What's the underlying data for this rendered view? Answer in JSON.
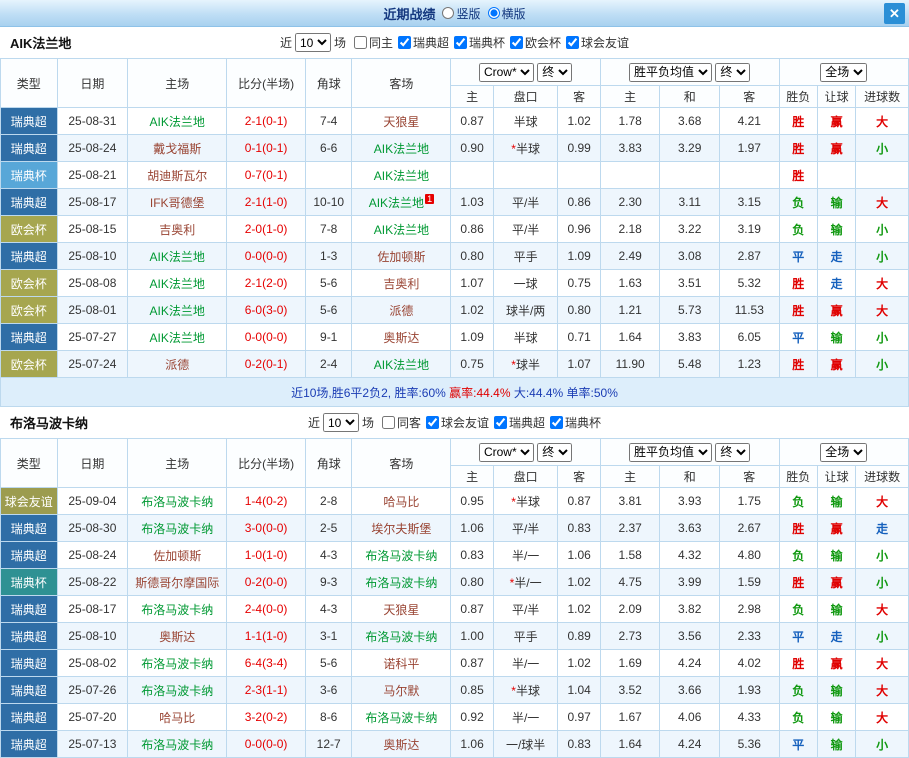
{
  "titlebar": {
    "title": "近期战绩",
    "vertical": "竖版",
    "horizontal": "横版",
    "selected": "横版",
    "close": "✕"
  },
  "controls": {
    "near": "近",
    "count": "10",
    "games": "场",
    "company": "Crow*",
    "final": "终",
    "avg": "胜平负均值",
    "full": "全场"
  },
  "columns": {
    "type": "类型",
    "date": "日期",
    "home": "主场",
    "score": "比分(半场)",
    "corner": "角球",
    "away": "客场",
    "h": "主",
    "handicap": "盘口",
    "a": "客",
    "avg_h": "主",
    "avg_d": "和",
    "avg_a": "客",
    "wl": "胜负",
    "let": "让球",
    "goals": "进球数"
  },
  "colors": {
    "result": {
      "胜": "#e00000",
      "负": "#119911",
      "平": "#1560bd",
      "赢": "#e00000",
      "输": "#119911",
      "走": "#1560bd",
      "大": "#e00000",
      "小": "#119911"
    },
    "focal_team": "#009933",
    "opponent": "#994433",
    "score": "#e60000"
  },
  "sections": [
    {
      "team": "AIK法兰地",
      "filters": [
        {
          "label": "同主",
          "checked": false
        },
        {
          "label": "瑞典超",
          "checked": true
        },
        {
          "label": "瑞典杯",
          "checked": true
        },
        {
          "label": "欧会杯",
          "checked": true
        },
        {
          "label": "球会友谊",
          "checked": true
        }
      ],
      "rows": [
        {
          "type": "瑞典超",
          "type_color": "#2f6ea6",
          "date": "25-08-31",
          "home": "AIK法兰地",
          "home_focal": true,
          "score": "2-1(0-1)",
          "corner": "7-4",
          "away": "天狼星",
          "away_focal": false,
          "away_sup": "",
          "odds_home": "0.87",
          "handicap": "半球",
          "odds_away": "1.02",
          "avg_home": "1.78",
          "avg_draw": "3.68",
          "avg_away": "4.21",
          "wl": "胜",
          "let": "赢",
          "goals": "大"
        },
        {
          "type": "瑞典超",
          "type_color": "#2f6ea6",
          "date": "25-08-24",
          "home": "戴戈福斯",
          "home_focal": false,
          "score": "0-1(0-1)",
          "corner": "6-6",
          "away": "AIK法兰地",
          "away_focal": true,
          "away_sup": "",
          "odds_home": "0.90",
          "handicap": "*半球",
          "odds_away": "0.99",
          "avg_home": "3.83",
          "avg_draw": "3.29",
          "avg_away": "1.97",
          "wl": "胜",
          "let": "赢",
          "goals": "小"
        },
        {
          "type": "瑞典杯",
          "type_color": "#58a7d8",
          "date": "25-08-21",
          "home": "胡迪斯瓦尔",
          "home_focal": false,
          "score": "0-7(0-1)",
          "corner": "",
          "away": "AIK法兰地",
          "away_focal": true,
          "away_sup": "",
          "odds_home": "",
          "handicap": "",
          "odds_away": "",
          "avg_home": "",
          "avg_draw": "",
          "avg_away": "",
          "wl": "胜",
          "let": "",
          "goals": ""
        },
        {
          "type": "瑞典超",
          "type_color": "#2f6ea6",
          "date": "25-08-17",
          "home": "IFK哥德堡",
          "home_focal": false,
          "score": "2-1(1-0)",
          "corner": "10-10",
          "away": "AIK法兰地",
          "away_focal": true,
          "away_sup": "1",
          "odds_home": "1.03",
          "handicap": "平/半",
          "odds_away": "0.86",
          "avg_home": "2.30",
          "avg_draw": "3.11",
          "avg_away": "3.15",
          "wl": "负",
          "let": "输",
          "goals": "大"
        },
        {
          "type": "欧会杯",
          "type_color": "#a6a64f",
          "date": "25-08-15",
          "home": "吉奥利",
          "home_focal": false,
          "score": "2-0(1-0)",
          "corner": "7-8",
          "away": "AIK法兰地",
          "away_focal": true,
          "away_sup": "",
          "odds_home": "0.86",
          "handicap": "平/半",
          "odds_away": "0.96",
          "avg_home": "2.18",
          "avg_draw": "3.22",
          "avg_away": "3.19",
          "wl": "负",
          "let": "输",
          "goals": "小"
        },
        {
          "type": "瑞典超",
          "type_color": "#2f6ea6",
          "date": "25-08-10",
          "home": "AIK法兰地",
          "home_focal": true,
          "score": "0-0(0-0)",
          "corner": "1-3",
          "away": "佐加顿斯",
          "away_focal": false,
          "away_sup": "",
          "odds_home": "0.80",
          "handicap": "平手",
          "odds_away": "1.09",
          "avg_home": "2.49",
          "avg_draw": "3.08",
          "avg_away": "2.87",
          "wl": "平",
          "let": "走",
          "goals": "小"
        },
        {
          "type": "欧会杯",
          "type_color": "#a6a64f",
          "date": "25-08-08",
          "home": "AIK法兰地",
          "home_focal": true,
          "score": "2-1(2-0)",
          "corner": "5-6",
          "away": "吉奥利",
          "away_focal": false,
          "away_sup": "",
          "odds_home": "1.07",
          "handicap": "一球",
          "odds_away": "0.75",
          "avg_home": "1.63",
          "avg_draw": "3.51",
          "avg_away": "5.32",
          "wl": "胜",
          "let": "走",
          "goals": "大"
        },
        {
          "type": "欧会杯",
          "type_color": "#a6a64f",
          "date": "25-08-01",
          "home": "AIK法兰地",
          "home_focal": true,
          "score": "6-0(3-0)",
          "corner": "5-6",
          "away": "派德",
          "away_focal": false,
          "away_sup": "",
          "odds_home": "1.02",
          "handicap": "球半/两",
          "odds_away": "0.80",
          "avg_home": "1.21",
          "avg_draw": "5.73",
          "avg_away": "11.53",
          "wl": "胜",
          "let": "赢",
          "goals": "大"
        },
        {
          "type": "瑞典超",
          "type_color": "#2f6ea6",
          "date": "25-07-27",
          "home": "AIK法兰地",
          "home_focal": true,
          "score": "0-0(0-0)",
          "corner": "9-1",
          "away": "奥斯达",
          "away_focal": false,
          "away_sup": "",
          "odds_home": "1.09",
          "handicap": "半球",
          "odds_away": "0.71",
          "avg_home": "1.64",
          "avg_draw": "3.83",
          "avg_away": "6.05",
          "wl": "平",
          "let": "输",
          "goals": "小"
        },
        {
          "type": "欧会杯",
          "type_color": "#a6a64f",
          "date": "25-07-24",
          "home": "派德",
          "home_focal": false,
          "score": "0-2(0-1)",
          "corner": "2-4",
          "away": "AIK法兰地",
          "away_focal": true,
          "away_sup": "",
          "odds_home": "0.75",
          "handicap": "*球半",
          "odds_away": "1.07",
          "avg_home": "11.90",
          "avg_draw": "5.48",
          "avg_away": "1.23",
          "wl": "胜",
          "let": "赢",
          "goals": "小"
        }
      ],
      "summary": [
        {
          "text": "近10场,胜6平2负2, 胜率:60%",
          "color": "#1a3cb4"
        },
        {
          "text": " 赢率:44.4%",
          "color": "#e00000"
        },
        {
          "text": " 大:44.4%",
          "color": "#1a3cb4"
        },
        {
          "text": " 单率:50%",
          "color": "#1a3cb4"
        }
      ]
    },
    {
      "team": "布洛马波卡纳",
      "filters": [
        {
          "label": "同客",
          "checked": false
        },
        {
          "label": "球会友谊",
          "checked": true
        },
        {
          "label": "瑞典超",
          "checked": true
        },
        {
          "label": "瑞典杯",
          "checked": true
        }
      ],
      "rows": [
        {
          "type": "球会友谊",
          "type_color": "#9c9c4f",
          "date": "25-09-04",
          "home": "布洛马波卡纳",
          "home_focal": true,
          "score": "1-4(0-2)",
          "corner": "2-8",
          "away": "哈马比",
          "away_focal": false,
          "away_sup": "",
          "odds_home": "0.95",
          "handicap": "*半球",
          "odds_away": "0.87",
          "avg_home": "3.81",
          "avg_draw": "3.93",
          "avg_away": "1.75",
          "wl": "负",
          "let": "输",
          "goals": "大"
        },
        {
          "type": "瑞典超",
          "type_color": "#2f6ea6",
          "date": "25-08-30",
          "home": "布洛马波卡纳",
          "home_focal": true,
          "score": "3-0(0-0)",
          "corner": "2-5",
          "away": "埃尔夫斯堡",
          "away_focal": false,
          "away_sup": "",
          "odds_home": "1.06",
          "handicap": "平/半",
          "odds_away": "0.83",
          "avg_home": "2.37",
          "avg_draw": "3.63",
          "avg_away": "2.67",
          "wl": "胜",
          "let": "赢",
          "goals": "走"
        },
        {
          "type": "瑞典超",
          "type_color": "#2f6ea6",
          "date": "25-08-24",
          "home": "佐加顿斯",
          "home_focal": false,
          "score": "1-0(1-0)",
          "corner": "4-3",
          "away": "布洛马波卡纳",
          "away_focal": true,
          "away_sup": "",
          "odds_home": "0.83",
          "handicap": "半/一",
          "odds_away": "1.06",
          "avg_home": "1.58",
          "avg_draw": "4.32",
          "avg_away": "4.80",
          "wl": "负",
          "let": "输",
          "goals": "小"
        },
        {
          "type": "瑞典杯",
          "type_color": "#2e9193",
          "date": "25-08-22",
          "home": "斯德哥尔摩国际",
          "home_focal": false,
          "score": "0-2(0-0)",
          "corner": "9-3",
          "away": "布洛马波卡纳",
          "away_focal": true,
          "away_sup": "",
          "odds_home": "0.80",
          "handicap": "*半/一",
          "odds_away": "1.02",
          "avg_home": "4.75",
          "avg_draw": "3.99",
          "avg_away": "1.59",
          "wl": "胜",
          "let": "赢",
          "goals": "小"
        },
        {
          "type": "瑞典超",
          "type_color": "#2f6ea6",
          "date": "25-08-17",
          "home": "布洛马波卡纳",
          "home_focal": true,
          "score": "2-4(0-0)",
          "corner": "4-3",
          "away": "天狼星",
          "away_focal": false,
          "away_sup": "",
          "odds_home": "0.87",
          "handicap": "平/半",
          "odds_away": "1.02",
          "avg_home": "2.09",
          "avg_draw": "3.82",
          "avg_away": "2.98",
          "wl": "负",
          "let": "输",
          "goals": "大"
        },
        {
          "type": "瑞典超",
          "type_color": "#2f6ea6",
          "date": "25-08-10",
          "home": "奥斯达",
          "home_focal": false,
          "score": "1-1(1-0)",
          "corner": "3-1",
          "away": "布洛马波卡纳",
          "away_focal": true,
          "away_sup": "",
          "odds_home": "1.00",
          "handicap": "平手",
          "odds_away": "0.89",
          "avg_home": "2.73",
          "avg_draw": "3.56",
          "avg_away": "2.33",
          "wl": "平",
          "let": "走",
          "goals": "小"
        },
        {
          "type": "瑞典超",
          "type_color": "#2f6ea6",
          "date": "25-08-02",
          "home": "布洛马波卡纳",
          "home_focal": true,
          "score": "6-4(3-4)",
          "corner": "5-6",
          "away": "诺科平",
          "away_focal": false,
          "away_sup": "",
          "odds_home": "0.87",
          "handicap": "半/一",
          "odds_away": "1.02",
          "avg_home": "1.69",
          "avg_draw": "4.24",
          "avg_away": "4.02",
          "wl": "胜",
          "let": "赢",
          "goals": "大"
        },
        {
          "type": "瑞典超",
          "type_color": "#2f6ea6",
          "date": "25-07-26",
          "home": "布洛马波卡纳",
          "home_focal": true,
          "score": "2-3(1-1)",
          "corner": "3-6",
          "away": "马尔默",
          "away_focal": false,
          "away_sup": "",
          "odds_home": "0.85",
          "handicap": "*半球",
          "odds_away": "1.04",
          "avg_home": "3.52",
          "avg_draw": "3.66",
          "avg_away": "1.93",
          "wl": "负",
          "let": "输",
          "goals": "大"
        },
        {
          "type": "瑞典超",
          "type_color": "#2f6ea6",
          "date": "25-07-20",
          "home": "哈马比",
          "home_focal": false,
          "score": "3-2(0-2)",
          "corner": "8-6",
          "away": "布洛马波卡纳",
          "away_focal": true,
          "away_sup": "",
          "odds_home": "0.92",
          "handicap": "半/一",
          "odds_away": "0.97",
          "avg_home": "1.67",
          "avg_draw": "4.06",
          "avg_away": "4.33",
          "wl": "负",
          "let": "输",
          "goals": "大"
        },
        {
          "type": "瑞典超",
          "type_color": "#2f6ea6",
          "date": "25-07-13",
          "home": "布洛马波卡纳",
          "home_focal": true,
          "score": "0-0(0-0)",
          "corner": "12-7",
          "away": "奥斯达",
          "away_focal": false,
          "away_sup": "",
          "odds_home": "1.06",
          "handicap": "一/球半",
          "odds_away": "0.83",
          "avg_home": "1.64",
          "avg_draw": "4.24",
          "avg_away": "5.36",
          "wl": "平",
          "let": "输",
          "goals": "小"
        }
      ],
      "summary": null
    }
  ]
}
